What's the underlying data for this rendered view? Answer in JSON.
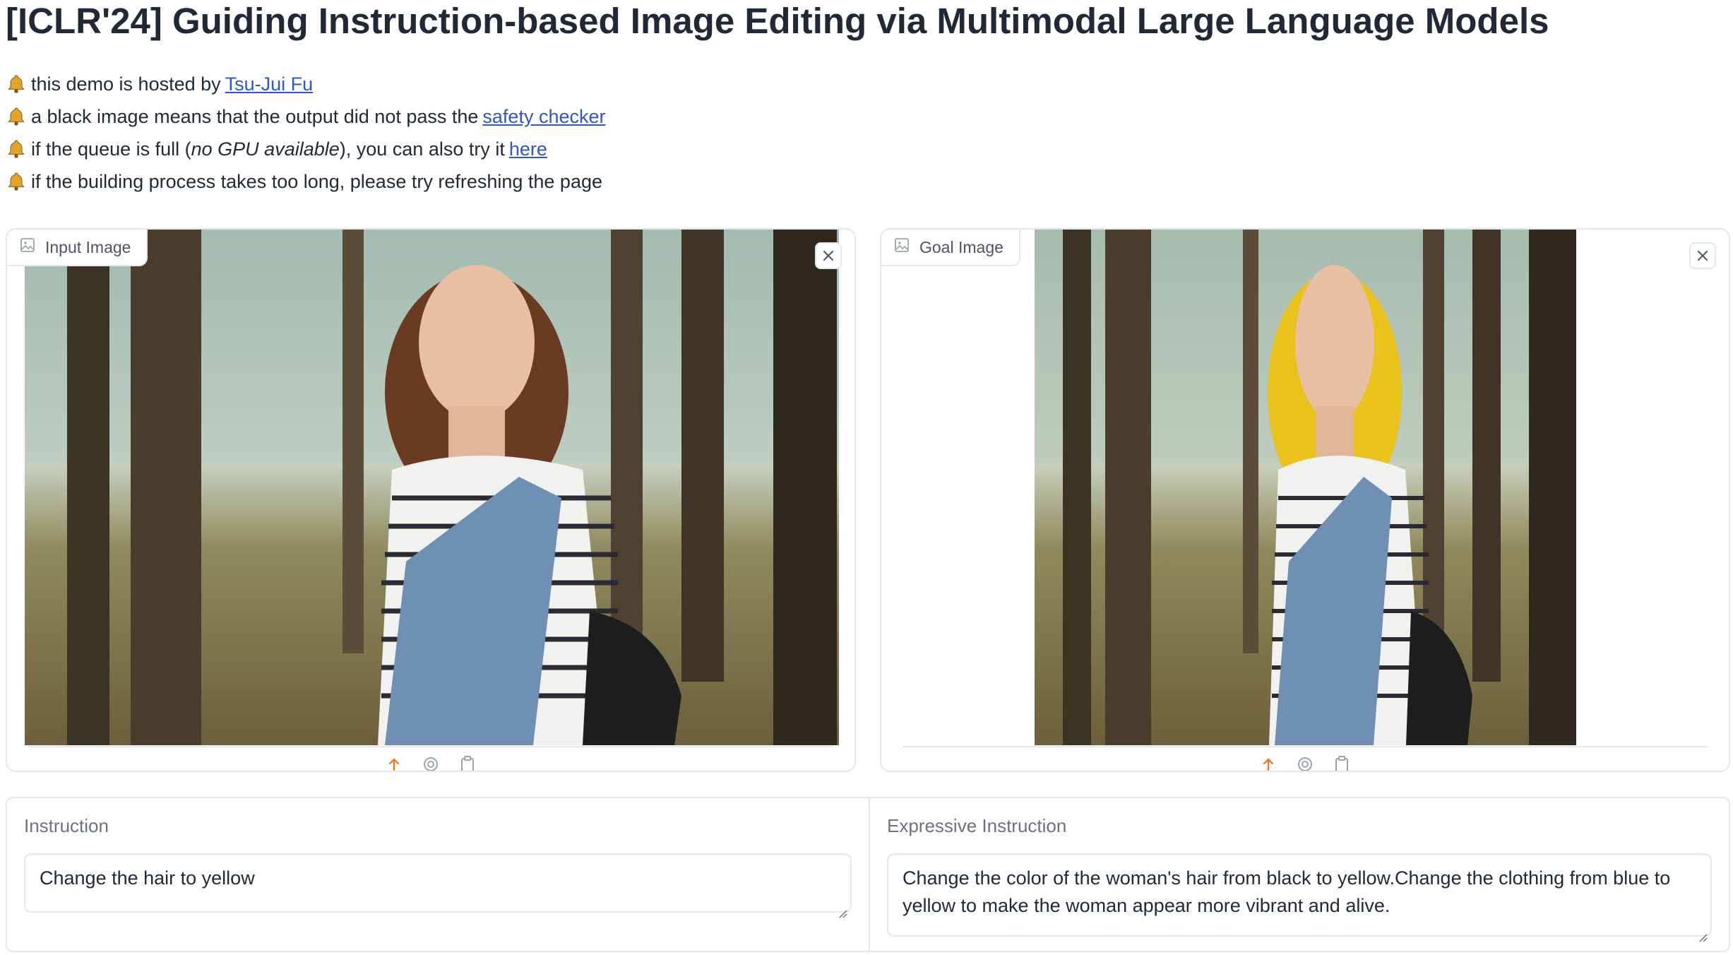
{
  "title": "[ICLR'24] Guiding Instruction-based Image Editing via Multimodal Large Language Models",
  "notes": {
    "n1_text": "this demo is hosted by",
    "n1_link": "Tsu-Jui Fu",
    "n2_text": "a black image means that the output did not pass the",
    "n2_link": "safety checker",
    "n3_pre": "if the queue is full (",
    "n3_em": "no GPU available",
    "n3_post": "), you can also try it",
    "n3_link": "here",
    "n4_text": "if the building process takes too long, please try refreshing the page"
  },
  "input_panel": {
    "label": "Input Image"
  },
  "goal_panel": {
    "label": "Goal Image"
  },
  "instruction": {
    "label": "Instruction",
    "value": "Change the hair to yellow"
  },
  "expressive_instruction": {
    "label": "Expressive Instruction",
    "value": "Change the color of the woman's hair from black to yellow.Change the clothing from blue to yellow to make the woman appear more vibrant and alive."
  },
  "colors": {
    "link": "#2f57c9",
    "upload_accent": "#f97316",
    "border": "#e5e7eb",
    "hair_original": "#6b3a22",
    "hair_edited": "#e9c21c"
  },
  "icons": [
    "bell-icon",
    "image-icon",
    "close-icon",
    "upload-icon",
    "webcam-icon",
    "clipboard-icon",
    "resize-handle-icon"
  ]
}
